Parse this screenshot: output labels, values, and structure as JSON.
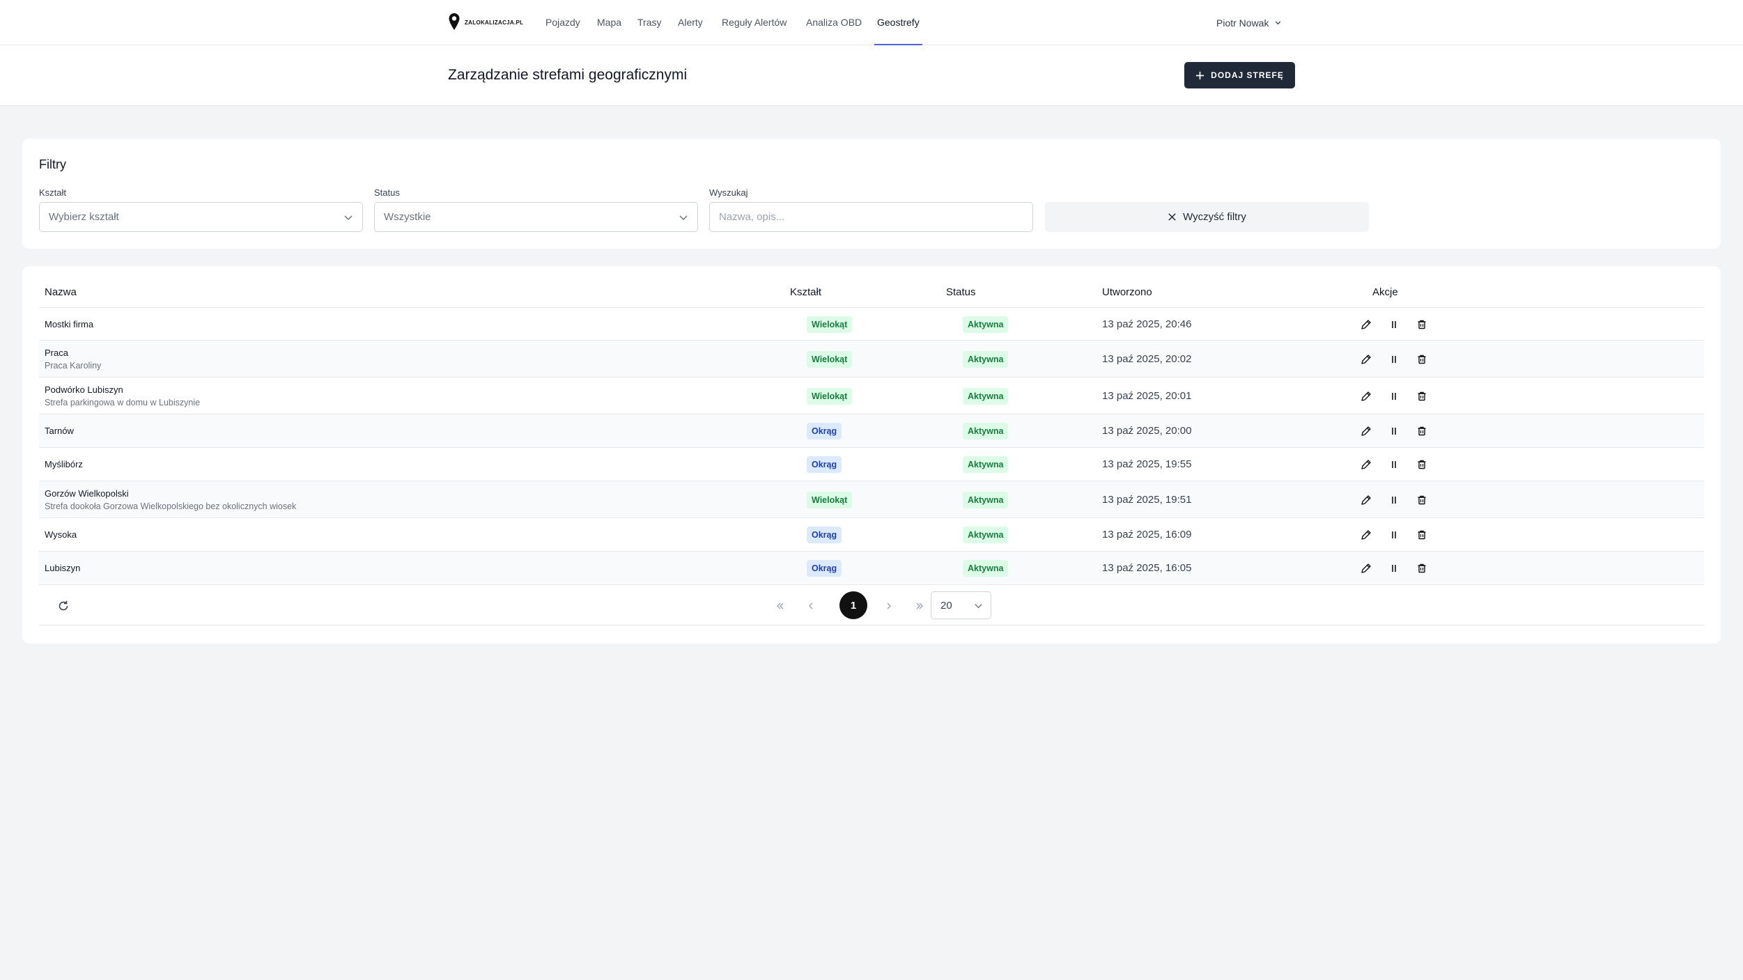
{
  "nav": {
    "brand": "ZALOKALIZACJA.PL",
    "links": [
      "Pojazdy",
      "Mapa",
      "Trasy",
      "Alerty",
      "Reguły Alertów",
      "Analiza OBD",
      "Geostrefy"
    ],
    "active": "Geostrefy",
    "user": "Piotr Nowak"
  },
  "header": {
    "title": "Zarządzanie strefami geograficznymi",
    "add_button": "DODAJ STREFĘ"
  },
  "filters": {
    "title": "Filtry",
    "shape_label": "Kształt",
    "shape_value": "Wybierz kształt",
    "status_label": "Status",
    "status_value": "Wszystkie",
    "search_label": "Wyszukaj",
    "search_placeholder": "Nazwa, opis...",
    "clear_button": "Wyczyść filtry"
  },
  "table": {
    "columns": [
      "Nazwa",
      "Kształt",
      "Status",
      "Utworzono",
      "Akcje"
    ],
    "rows": [
      {
        "name": "Mostki firma",
        "desc": "",
        "shape": "Wielokąt",
        "status": "Aktywna",
        "created": "13 paź 2025, 20:46"
      },
      {
        "name": "Praca",
        "desc": "Praca Karoliny",
        "shape": "Wielokąt",
        "status": "Aktywna",
        "created": "13 paź 2025, 20:02"
      },
      {
        "name": "Podwórko Lubiszyn",
        "desc": "Strefa parkingowa w domu w Lubiszynie",
        "shape": "Wielokąt",
        "status": "Aktywna",
        "created": "13 paź 2025, 20:01"
      },
      {
        "name": "Tarnów",
        "desc": "",
        "shape": "Okrąg",
        "status": "Aktywna",
        "created": "13 paź 2025, 20:00"
      },
      {
        "name": "Myślibórz",
        "desc": "",
        "shape": "Okrąg",
        "status": "Aktywna",
        "created": "13 paź 2025, 19:55"
      },
      {
        "name": "Gorzów Wielkopolski",
        "desc": "Strefa dookoła Gorzowa Wielkopolskiego bez okolicznych wiosek",
        "shape": "Wielokąt",
        "status": "Aktywna",
        "created": "13 paź 2025, 19:51"
      },
      {
        "name": "Wysoka",
        "desc": "",
        "shape": "Okrąg",
        "status": "Aktywna",
        "created": "13 paź 2025, 16:09"
      },
      {
        "name": "Lubiszyn",
        "desc": "",
        "shape": "Okrąg",
        "status": "Aktywna",
        "created": "13 paź 2025, 16:05"
      }
    ]
  },
  "pagination": {
    "current_page": "1",
    "page_size": "20"
  },
  "colors": {
    "badge_polygon": "#dcfce7",
    "badge_circle": "#dbeafe",
    "primary": "#1f2937",
    "nav_active": "#4f63d2"
  }
}
